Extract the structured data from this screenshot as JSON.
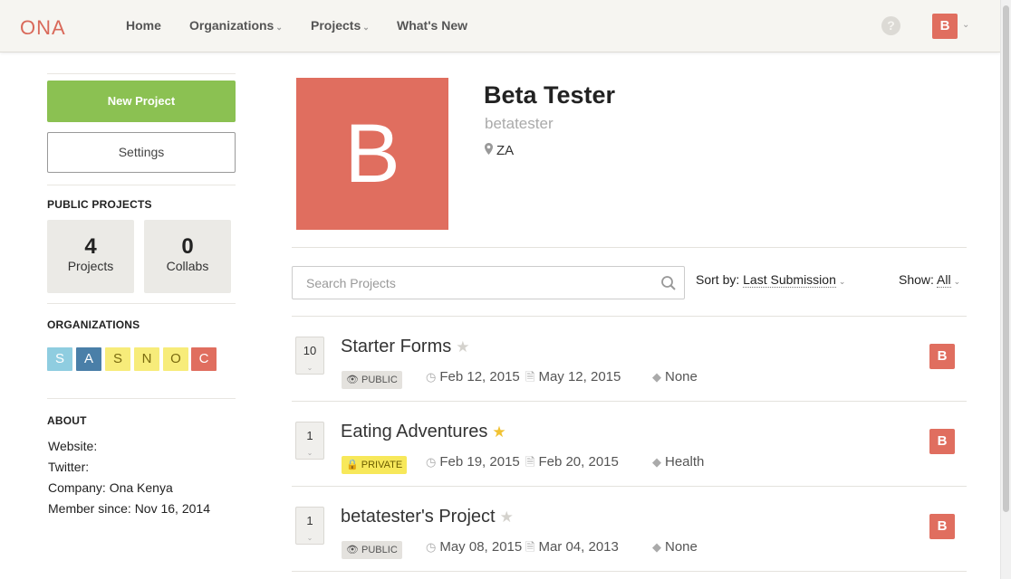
{
  "nav": {
    "logo": "ONA",
    "items": [
      {
        "label": "Home",
        "caret": false
      },
      {
        "label": "Organizations",
        "caret": true
      },
      {
        "label": "Projects",
        "caret": true
      },
      {
        "label": "What's New",
        "caret": false
      }
    ],
    "help_icon": "question-icon",
    "user_initial": "B"
  },
  "sidebar": {
    "new_project_label": "New Project",
    "settings_label": "Settings",
    "public_projects_heading": "PUBLIC PROJECTS",
    "stats": [
      {
        "value": "4",
        "label": "Projects"
      },
      {
        "value": "0",
        "label": "Collabs"
      }
    ],
    "organizations_heading": "ORGANIZATIONS",
    "organizations": [
      {
        "letter": "S",
        "color": "#8fcde0",
        "text_color": "#ffffff"
      },
      {
        "letter": "A",
        "color": "#4a7fa8",
        "text_color": "#ffffff"
      },
      {
        "letter": "S",
        "color": "#f7ec7a",
        "text_color": "#7a6b10"
      },
      {
        "letter": "N",
        "color": "#f7ec7a",
        "text_color": "#7a6b10"
      },
      {
        "letter": "O",
        "color": "#f7ec7a",
        "text_color": "#7a6b10"
      },
      {
        "letter": "C",
        "color": "#e06e5f",
        "text_color": "#ffffff"
      }
    ],
    "about_heading": "ABOUT",
    "about": {
      "website": "Website:",
      "twitter": "Twitter:",
      "company": "Company: Ona Kenya",
      "member_since": "Member since: Nov 16, 2014"
    }
  },
  "profile": {
    "avatar_initial": "B",
    "name": "Beta Tester",
    "username": "betatester",
    "location": "ZA"
  },
  "toolbar": {
    "search_placeholder": "Search Projects",
    "sort_prefix": "Sort by:",
    "sort_value": "Last Submission",
    "show_prefix": "Show:",
    "show_value": "All"
  },
  "projects": [
    {
      "count": "10",
      "title": "Starter Forms",
      "starred": false,
      "visibility": "PUBLIC",
      "created": "Feb 12, 2015",
      "updated": "May 12, 2015",
      "tag": "None",
      "owner_initial": "B"
    },
    {
      "count": "1",
      "title": "Eating Adventures",
      "starred": true,
      "visibility": "PRIVATE",
      "created": "Feb 19, 2015",
      "updated": "Feb 20, 2015",
      "tag": "Health",
      "owner_initial": "B"
    },
    {
      "count": "1",
      "title": "betatester's Project",
      "starred": false,
      "visibility": "PUBLIC",
      "created": "May 08, 2015",
      "updated": "Mar 04, 2013",
      "tag": "None",
      "owner_initial": "B"
    }
  ],
  "colors": {
    "brand": "#e06e5f",
    "new_project_green": "#8bc152",
    "private_yellow": "#f7e85a",
    "star_on": "#f1c232"
  }
}
